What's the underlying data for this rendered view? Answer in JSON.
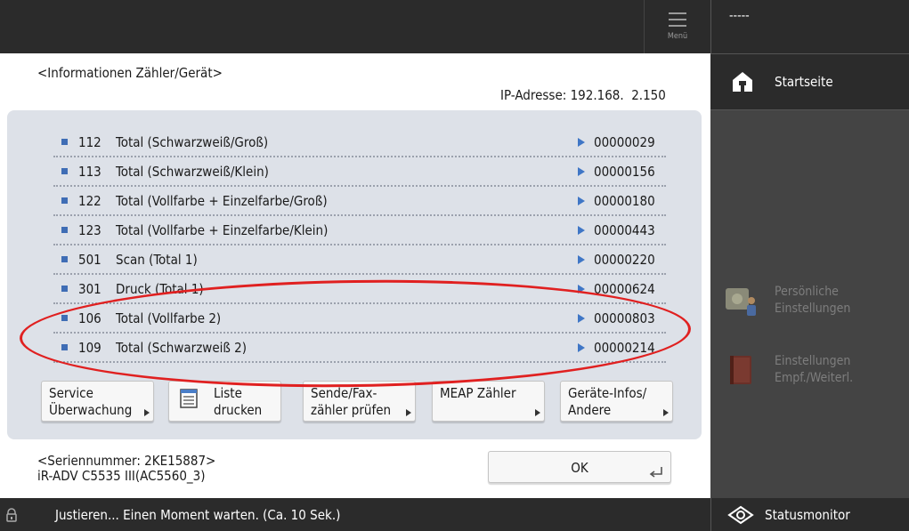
{
  "header": {
    "menu_label": "Menü",
    "user": "-----"
  },
  "page": {
    "title": "<Informationen Zähler/Gerät>",
    "ip_address": "IP-Adresse: 192.168.  2.150"
  },
  "counters": [
    {
      "num": "112",
      "label": "Total (Schwarzweiß/Groß)",
      "value": "00000029"
    },
    {
      "num": "113",
      "label": "Total (Schwarzweiß/Klein)",
      "value": "00000156"
    },
    {
      "num": "122",
      "label": "Total (Vollfarbe + Einzelfarbe/Groß)",
      "value": "00000180"
    },
    {
      "num": "123",
      "label": "Total (Vollfarbe + Einzelfarbe/Klein)",
      "value": "00000443"
    },
    {
      "num": "501",
      "label": "Scan (Total 1)",
      "value": "00000220"
    },
    {
      "num": "301",
      "label": "Druck (Total 1)",
      "value": "00000624"
    },
    {
      "num": "106",
      "label": "Total (Vollfarbe 2)",
      "value": "00000803"
    },
    {
      "num": "109",
      "label": "Total (Schwarzweiß 2)",
      "value": "00000214"
    }
  ],
  "buttons": {
    "service": {
      "line1": "Service",
      "line2": "Überwachung"
    },
    "print_list": {
      "line1": "Liste",
      "line2": "drucken"
    },
    "send_fax": {
      "line1": "Sende/Fax-",
      "line2": "zähler prüfen"
    },
    "meap": {
      "line1": "MEAP Zähler",
      "line2": ""
    },
    "device_info": {
      "line1": "Geräte-Infos/",
      "line2": "Andere"
    }
  },
  "footer": {
    "serial": "<Seriennummer: 2KE15887>",
    "model": "iR-ADV C5535 III(AC5560_3)",
    "ok_label": "OK"
  },
  "status_bar": {
    "message": "Justieren... Einen Moment warten. (Ca. 10   Sek.)"
  },
  "sidebar": {
    "home": "Startseite",
    "personal_1": "Persönliche",
    "personal_2": "Einstellungen",
    "settings_1": "Einstellungen",
    "settings_2": "Empf./Weiterl.",
    "status_monitor": "Statusmonitor"
  },
  "colors": {
    "annotation": "#e02020",
    "bullet": "#3f6db5",
    "panel": "#dde1e8",
    "dark": "#2b2b2b"
  }
}
